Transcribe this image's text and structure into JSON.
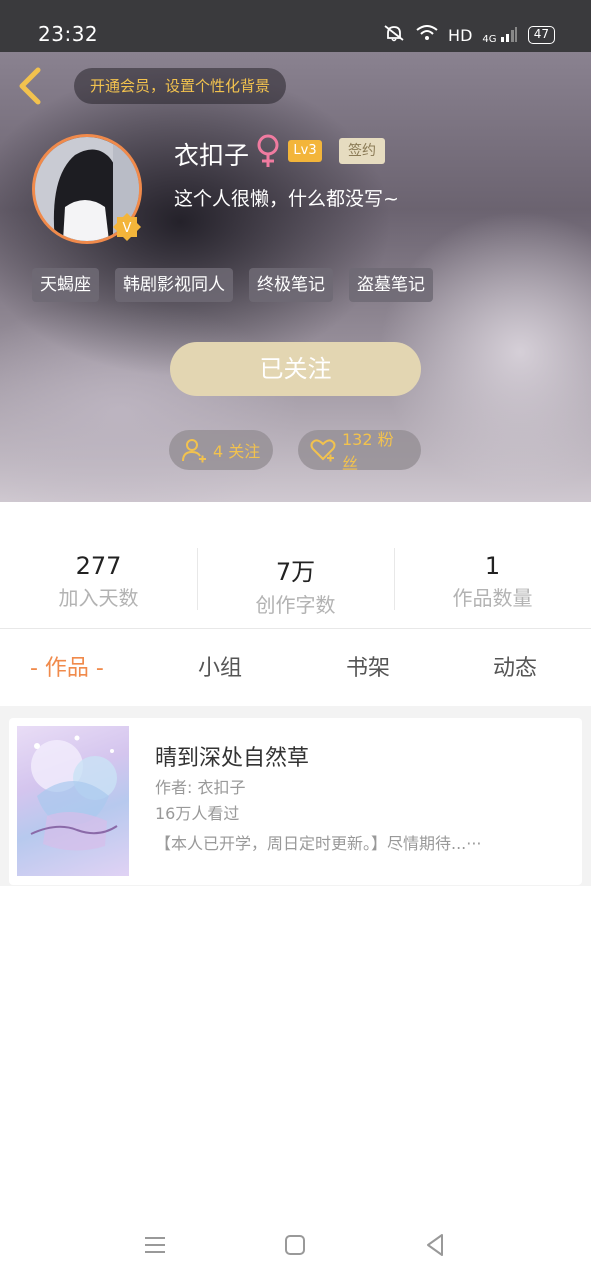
{
  "status_bar": {
    "time": "23:32",
    "network": "HD",
    "cell": "4G",
    "battery": "47"
  },
  "header": {
    "vip_banner": "开通会员，设置个性化背景",
    "username": "衣扣子",
    "level": "Lv3",
    "sign_badge": "签约",
    "bio": "这个人很懒，什么都没写~",
    "tags": [
      "天蝎座",
      "韩剧影视同人",
      "终极笔记",
      "盗墓笔记"
    ],
    "follow_button": "已关注",
    "following": "4 关注",
    "fans": "132 粉丝"
  },
  "stats": [
    {
      "value": "277",
      "label": "加入天数"
    },
    {
      "value": "7万",
      "label": "创作字数"
    },
    {
      "value": "1",
      "label": "作品数量"
    }
  ],
  "tabs": [
    "- 作品 -",
    "小组",
    "书架",
    "动态"
  ],
  "works": [
    {
      "title": "晴到深处自然草",
      "author": "作者: 衣扣子",
      "views": "16万人看过",
      "description": "【本人已开学，周日定时更新。】尽情期待...···"
    }
  ],
  "colors": {
    "accent": "#f08a4b",
    "gold": "#f2c24e",
    "follow_button": "#e3d6b2"
  },
  "icons": [
    "back-arrow-icon",
    "female-icon",
    "v-badge-icon",
    "person-add-icon",
    "heart-icon",
    "menu-icon",
    "home-icon",
    "back-icon"
  ]
}
